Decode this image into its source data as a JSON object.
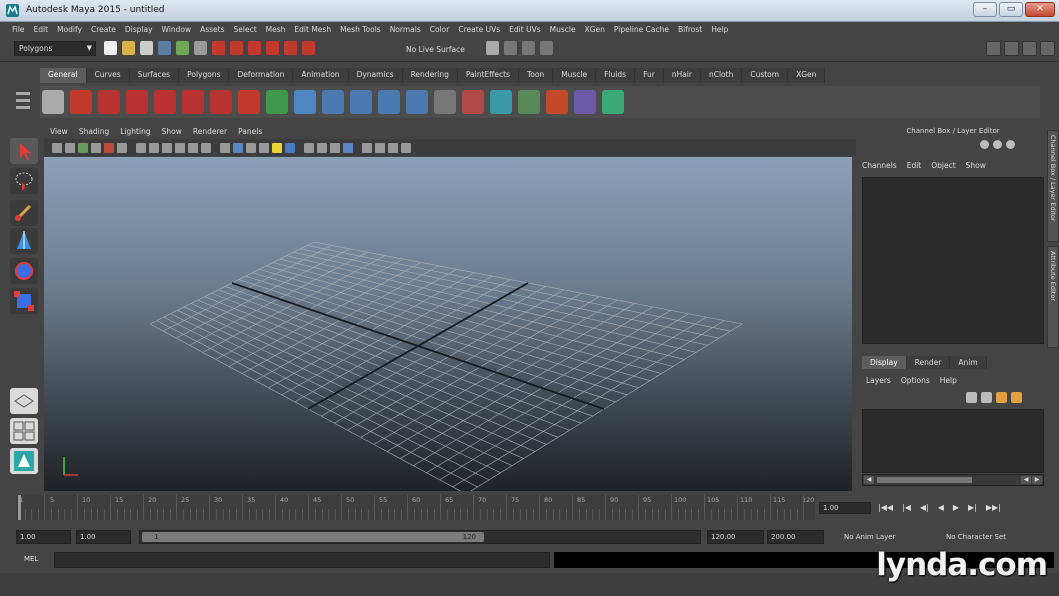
{
  "window": {
    "title": "Autodesk Maya 2015 - untitled",
    "minimize": "–",
    "restore": "▭",
    "close": "✕"
  },
  "menubar": [
    "File",
    "Edit",
    "Modify",
    "Create",
    "Display",
    "Window",
    "Assets",
    "Select",
    "Mesh",
    "Edit Mesh",
    "Mesh Tools",
    "Normals",
    "Color",
    "Create UVs",
    "Edit UVs",
    "Muscle",
    "XGen",
    "Pipeline Cache",
    "Bifrost",
    "Help"
  ],
  "statusline": {
    "mode": "Polygons",
    "live_surface": "No Live Surface"
  },
  "shelf": {
    "tabs": [
      "General",
      "Curves",
      "Surfaces",
      "Polygons",
      "Deformation",
      "Animation",
      "Dynamics",
      "Rendering",
      "PaintEffects",
      "Toon",
      "Muscle",
      "Fluids",
      "Fur",
      "nHair",
      "nCloth",
      "Custom",
      "XGen"
    ],
    "active_tab": "General"
  },
  "viewport": {
    "menu": [
      "View",
      "Shading",
      "Lighting",
      "Show",
      "Renderer",
      "Panels"
    ]
  },
  "channel_box": {
    "header": "Channel Box / Layer Editor",
    "menu": [
      "Channels",
      "Edit",
      "Object",
      "Show"
    ],
    "side_tab_1": "Channel Box / Layer Editor",
    "side_tab_2": "Attribute Editor"
  },
  "layer_editor": {
    "tabs": [
      "Display",
      "Render",
      "Anim"
    ],
    "active_tab": "Display",
    "menu": [
      "Layers",
      "Options",
      "Help"
    ]
  },
  "time_slider": {
    "labels": [
      "1",
      "5",
      "10",
      "15",
      "20",
      "25",
      "30",
      "35",
      "40",
      "45",
      "50",
      "55",
      "60",
      "65",
      "70",
      "75",
      "80",
      "85",
      "90",
      "95",
      "100",
      "105",
      "110",
      "115",
      "120"
    ],
    "current_frame": "1.00",
    "playback": [
      "|◀◀",
      "|◀",
      "◀|",
      "◀",
      "▶",
      "▶|",
      "▶▶|",
      "▶▶|"
    ]
  },
  "range": {
    "start": "1.00",
    "playback_start": "1.00",
    "thumb_start": "1",
    "thumb_end": "120",
    "playback_end": "120.00",
    "end": "200.00",
    "anim_layer": "No Anim Layer",
    "character_set": "No Character Set"
  },
  "command_line": {
    "label": "MEL"
  },
  "watermark": "lynda.com"
}
